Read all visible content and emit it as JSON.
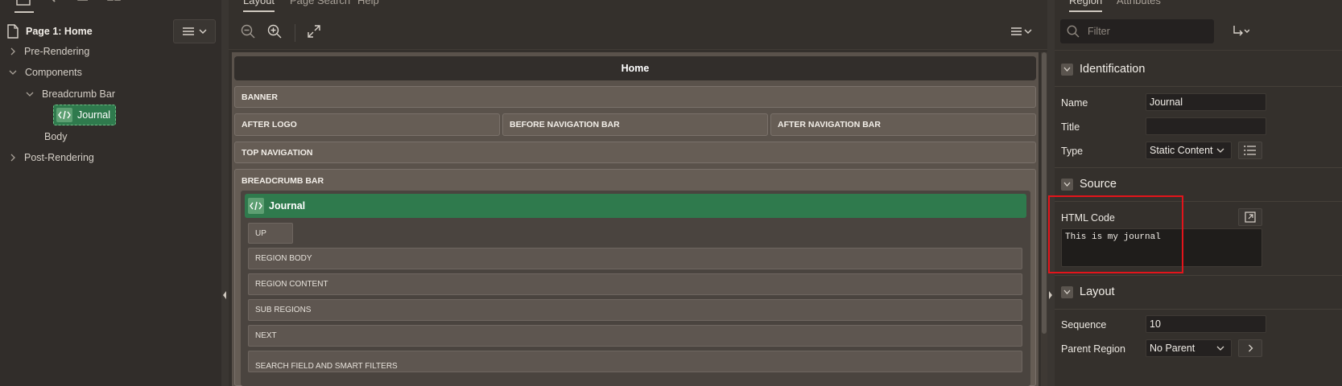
{
  "left_pane": {
    "root": "Page 1: Home",
    "tree": [
      {
        "label": "Pre-Rendering",
        "level": 1,
        "expanded": false
      },
      {
        "label": "Components",
        "level": 1,
        "expanded": true
      },
      {
        "label": "Breadcrumb Bar",
        "level": 2,
        "expanded": true
      },
      {
        "label": "Journal",
        "level": 3,
        "selected": true
      },
      {
        "label": "Body",
        "level": 2
      },
      {
        "label": "Post-Rendering",
        "level": 1,
        "expanded": false
      }
    ]
  },
  "center_pane": {
    "tabs": [
      "Layout",
      "Page Search",
      "Help"
    ],
    "active_tab": "Layout",
    "page_title": "Home",
    "regions": {
      "banner": "BANNER",
      "after_logo": "AFTER LOGO",
      "before_nav": "BEFORE NAVIGATION BAR",
      "after_nav": "AFTER NAVIGATION BAR",
      "top_nav": "TOP NAVIGATION",
      "breadcrumb": "BREADCRUMB BAR"
    },
    "journal_region": "Journal",
    "sub_slots": [
      "UP",
      "REGION BODY",
      "REGION CONTENT",
      "SUB REGIONS",
      "NEXT",
      "SEARCH FIELD AND SMART FILTERS"
    ]
  },
  "right_pane": {
    "tabs": [
      "Region",
      "Attributes"
    ],
    "active_tab": "Region",
    "filter_placeholder": "Filter",
    "sections": {
      "identification": "Identification",
      "source": "Source",
      "layout": "Layout"
    },
    "fields": {
      "name_label": "Name",
      "name_value": "Journal",
      "title_label": "Title",
      "title_value": "",
      "type_label": "Type",
      "type_value": "Static Content",
      "html_code_label": "HTML Code",
      "html_code_value": "This is my journal",
      "sequence_label": "Sequence",
      "sequence_value": "10",
      "parent_region_label": "Parent Region",
      "parent_region_value": "No Parent"
    }
  },
  "colors": {
    "selected_region": "#2f7a4d",
    "highlight_box": "#e3141b"
  }
}
